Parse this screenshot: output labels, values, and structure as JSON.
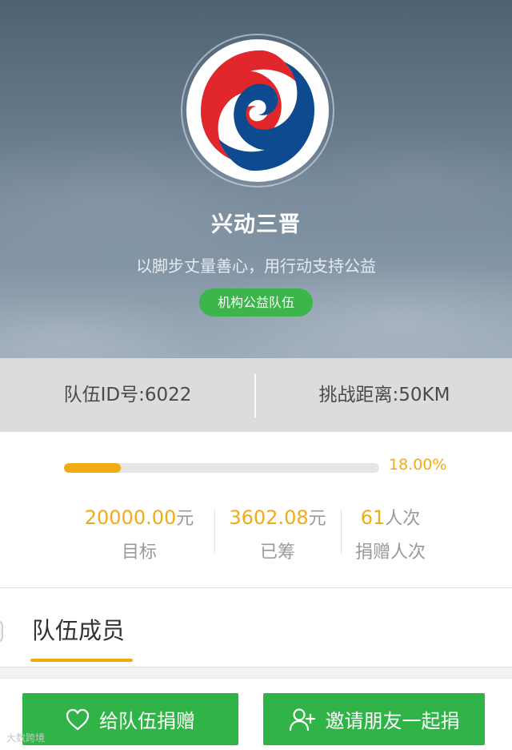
{
  "team": {
    "name": "兴动三晋",
    "slogan": "以脚步丈量善心，用行动支持公益",
    "tag": "机构公益队伍",
    "logo_icon": "shanxi-swirl-logo",
    "colors": {
      "logo_red": "#e1262c",
      "logo_blue": "#0d4a8f",
      "tag_green": "#3cb54a"
    }
  },
  "info": {
    "team_id": "队伍ID号:6022",
    "challenge_distance": "挑战距离:50KM"
  },
  "progress": {
    "fraction": 0.18,
    "percent_text": "18.00%",
    "color": "#f2ab12"
  },
  "stats": [
    {
      "value": "20000.00",
      "unit": "元",
      "label": "目标"
    },
    {
      "value": "3602.08",
      "unit": "元",
      "label": "已筹"
    },
    {
      "value": "61",
      "unit": "人次",
      "label": "捐赠人次"
    }
  ],
  "members": {
    "tab_label": "队伍成员"
  },
  "actions": {
    "donate": {
      "label": "给队伍捐赠",
      "icon": "heart-icon"
    },
    "invite": {
      "label": "邀请朋友一起捐",
      "icon": "add-user-icon"
    },
    "button_color": "#31b447"
  },
  "watermark": {
    "text": "大数跨境"
  }
}
